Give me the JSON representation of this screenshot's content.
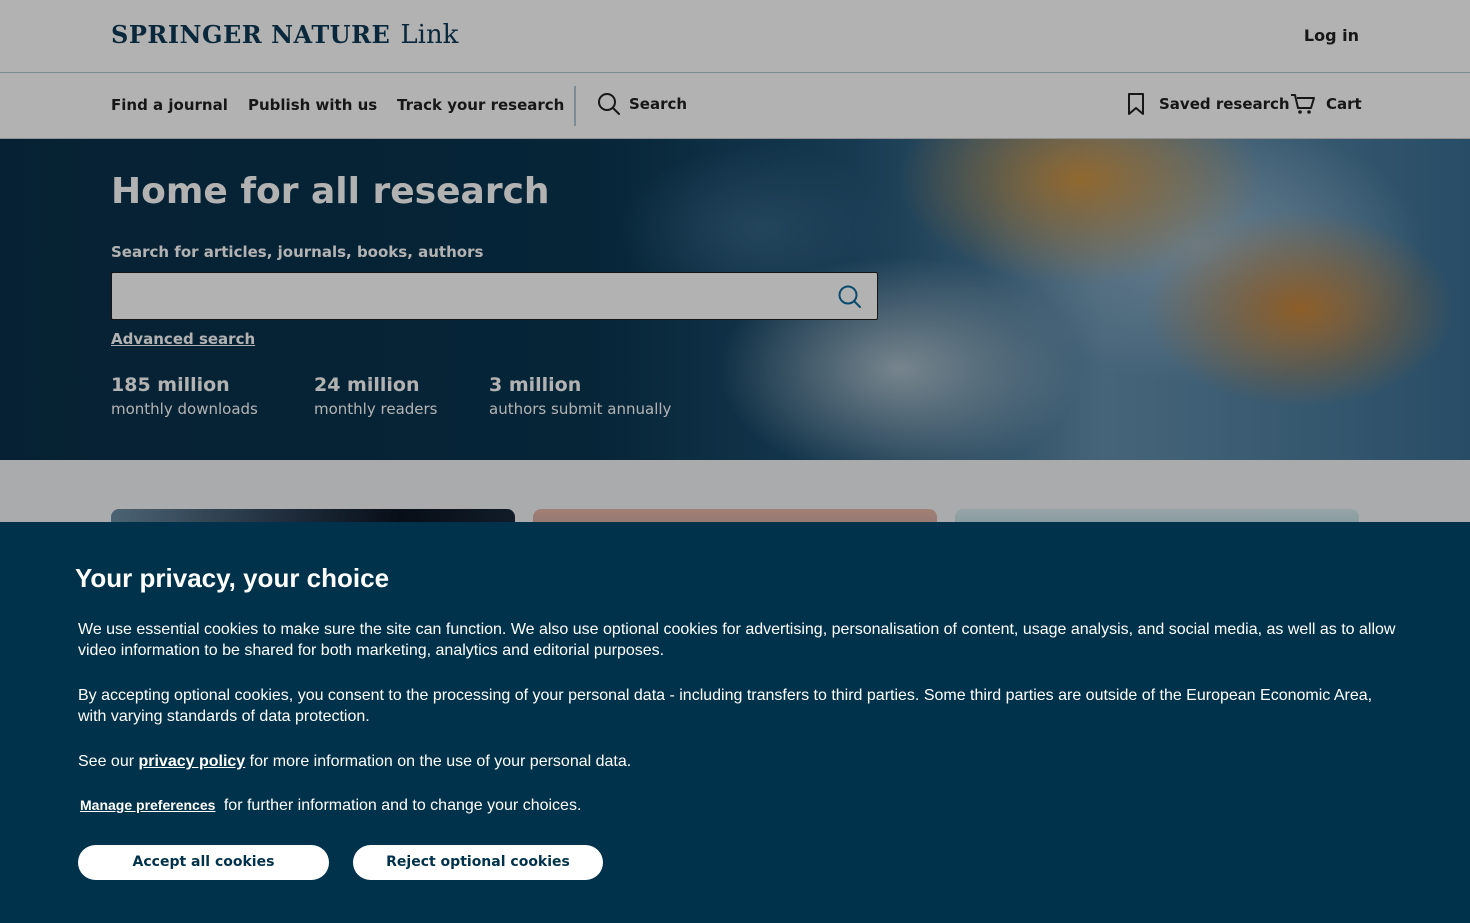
{
  "header": {
    "logo_main": "SPRINGER NATURE",
    "logo_link": "Link",
    "login_label": "Log in"
  },
  "nav": {
    "find_journal": "Find a journal",
    "publish": "Publish with us",
    "track": "Track your research",
    "search": "Search",
    "saved": "Saved research",
    "cart": "Cart"
  },
  "hero": {
    "title": "Home for all research",
    "search_label": "Search for articles, journals, books, authors",
    "search_value": "",
    "advanced_search": "Advanced search",
    "stats": [
      {
        "number": "185 million",
        "label": "monthly downloads"
      },
      {
        "number": "24 million",
        "label": "monthly readers"
      },
      {
        "number": "3 million",
        "label": "authors submit annually"
      }
    ]
  },
  "cookie": {
    "title": "Your privacy, your choice",
    "p1": "We use essential cookies to make sure the site can function. We also use optional cookies for advertising, personalisation of content, usage analysis, and social media, as well as to allow video information to be shared for both marketing, analytics and editorial purposes.",
    "p2": "By accepting optional cookies, you consent to the processing of your personal data - including transfers to third parties. Some third parties are outside of the European Economic Area, with varying standards of data protection.",
    "p3_pre": "See our ",
    "p3_link": "privacy policy",
    "p3_post": " for more information on the use of your personal data.",
    "p4_link": "Manage preferences",
    "p4_post": " for further information and to change your choices.",
    "accept_label": "Accept all cookies",
    "reject_label": "Reject optional cookies"
  },
  "colors": {
    "brand_navy": "#01324b",
    "logo_blue": "#0f3a57",
    "divider": "#b3c7d3"
  },
  "icons": {
    "nav_search": "search-icon",
    "saved": "bookmark-icon",
    "cart": "cart-icon",
    "hero_search": "search-icon"
  }
}
